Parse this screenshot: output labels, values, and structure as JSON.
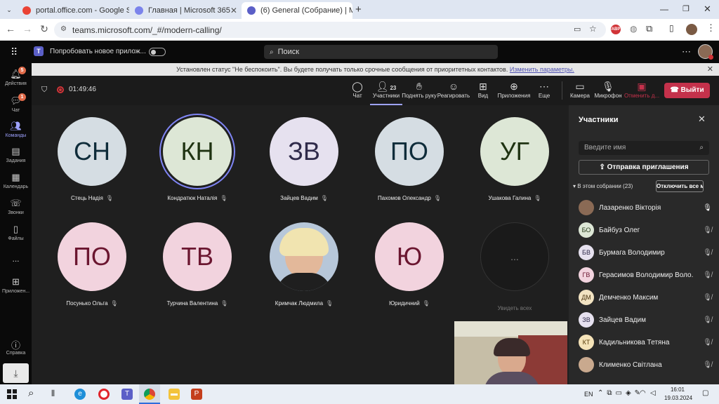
{
  "browser": {
    "tabs": [
      {
        "label": "portal.office.com - Google Sear",
        "color": "#4285f4"
      },
      {
        "label": "Главная | Microsoft 365",
        "color": "#7b83eb"
      },
      {
        "label": "(6) General (Собрание) | M",
        "color": "#5b5fc7"
      }
    ],
    "url": "teams.microsoft.com/_#/modern-calling/"
  },
  "teams": {
    "try_new": "Попробовать новое прилож...",
    "search_placeholder": "Поиск"
  },
  "rail": {
    "activity": {
      "label": "Действия",
      "badge": "5"
    },
    "chat": {
      "label": "Чат",
      "badge": "1"
    },
    "teams": {
      "label": "Команды"
    },
    "tasks": {
      "label": "Задания"
    },
    "calendar": {
      "label": "Календарь"
    },
    "calls": {
      "label": "Звонки"
    },
    "files": {
      "label": "Файлы"
    },
    "more": {
      "label": "..."
    },
    "apps": {
      "label": "Приложен..."
    },
    "help": {
      "label": "Справка"
    }
  },
  "banner": {
    "text": "Установлен статус \"Не беспокоить\". Вы будете получать только срочные сообщения от приоритетных контактов.",
    "link": "Изменить параметры."
  },
  "meeting": {
    "timer": "01:49:46",
    "toolbar": {
      "chat": "Чат",
      "participants": "Участники",
      "participants_count": "23",
      "raise_hand": "Поднять руку",
      "react": "Реагировать",
      "view": "Вид",
      "apps": "Приложения",
      "more": "Еще",
      "camera": "Камера",
      "mic": "Микрофон",
      "share": "Отменить д...",
      "leave": "Выйти"
    },
    "tiles": [
      {
        "initials": "СН",
        "name": "Стець Надія",
        "bg": "#d5dde3",
        "fg": "#0f2c3a",
        "speaking": false
      },
      {
        "initials": "КН",
        "name": "Кондратюк Наталія",
        "bg": "#dde7d6",
        "fg": "#1f3312",
        "speaking": true
      },
      {
        "initials": "ЗВ",
        "name": "Зайцев Вадим",
        "bg": "#e6e1ef",
        "fg": "#2f2a4a",
        "speaking": false
      },
      {
        "initials": "ПО",
        "name": "Пахомов Олександр",
        "bg": "#d5dde3",
        "fg": "#0f2c3a",
        "speaking": false
      },
      {
        "initials": "УГ",
        "name": "Ушакова Галина",
        "bg": "#dde7d6",
        "fg": "#1f3312",
        "speaking": false
      },
      {
        "initials": "ПО",
        "name": "Посунько Ольга",
        "bg": "#f2d3de",
        "fg": "#6b1630",
        "speaking": false
      },
      {
        "initials": "ТВ",
        "name": "Турчина Валентина",
        "bg": "#f2d3de",
        "fg": "#6b1630",
        "speaking": false
      },
      {
        "initials": "",
        "name": "Кримчак Людмила",
        "bg": "#b7c7d9",
        "fg": "#333",
        "speaking": false,
        "photo": true
      },
      {
        "initials": "Ю",
        "name": "Юридичний",
        "bg": "#f2d3de",
        "fg": "#6b1630",
        "speaking": false
      },
      {
        "initials": "...",
        "name": "Увидеть всех",
        "bg": "#1a1a1a",
        "fg": "#888",
        "speaking": false
      }
    ]
  },
  "panel": {
    "title": "Участники",
    "search_placeholder": "Введите имя",
    "invite": "Отправка приглашения",
    "section": "В этом собрании (23)",
    "mute_all": "Отключить все мик...",
    "people": [
      {
        "initials": "",
        "name": "Лазаренко Вікторія",
        "bg": "#8a6a55",
        "fg": "#fff",
        "mic": "on"
      },
      {
        "initials": "БО",
        "name": "Байбуз Олег",
        "bg": "#dde7d6",
        "fg": "#1f3312",
        "mic": "off"
      },
      {
        "initials": "БВ",
        "name": "Бурмага Володимир",
        "bg": "#e6e1ef",
        "fg": "#2f2a4a",
        "mic": "off"
      },
      {
        "initials": "ГВ",
        "name": "Герасимов Володимир Воло...",
        "bg": "#f2d3de",
        "fg": "#6b1630",
        "mic": "off"
      },
      {
        "initials": "ДМ",
        "name": "Демченко Максим",
        "bg": "#f2e3c2",
        "fg": "#4a3410",
        "mic": "off"
      },
      {
        "initials": "ЗВ",
        "name": "Зайцев Вадим",
        "bg": "#e6e1ef",
        "fg": "#2f2a4a",
        "mic": "off"
      },
      {
        "initials": "КТ",
        "name": "Кадильникова Тетяна",
        "bg": "#f5e3b8",
        "fg": "#5a3e0c",
        "mic": "off"
      },
      {
        "initials": "",
        "name": "Клименко Світлана",
        "bg": "#c9a98e",
        "fg": "#fff",
        "mic": "off"
      }
    ]
  },
  "taskbar": {
    "lang": "EN",
    "time": "16:01",
    "date": "19.03.2024"
  }
}
